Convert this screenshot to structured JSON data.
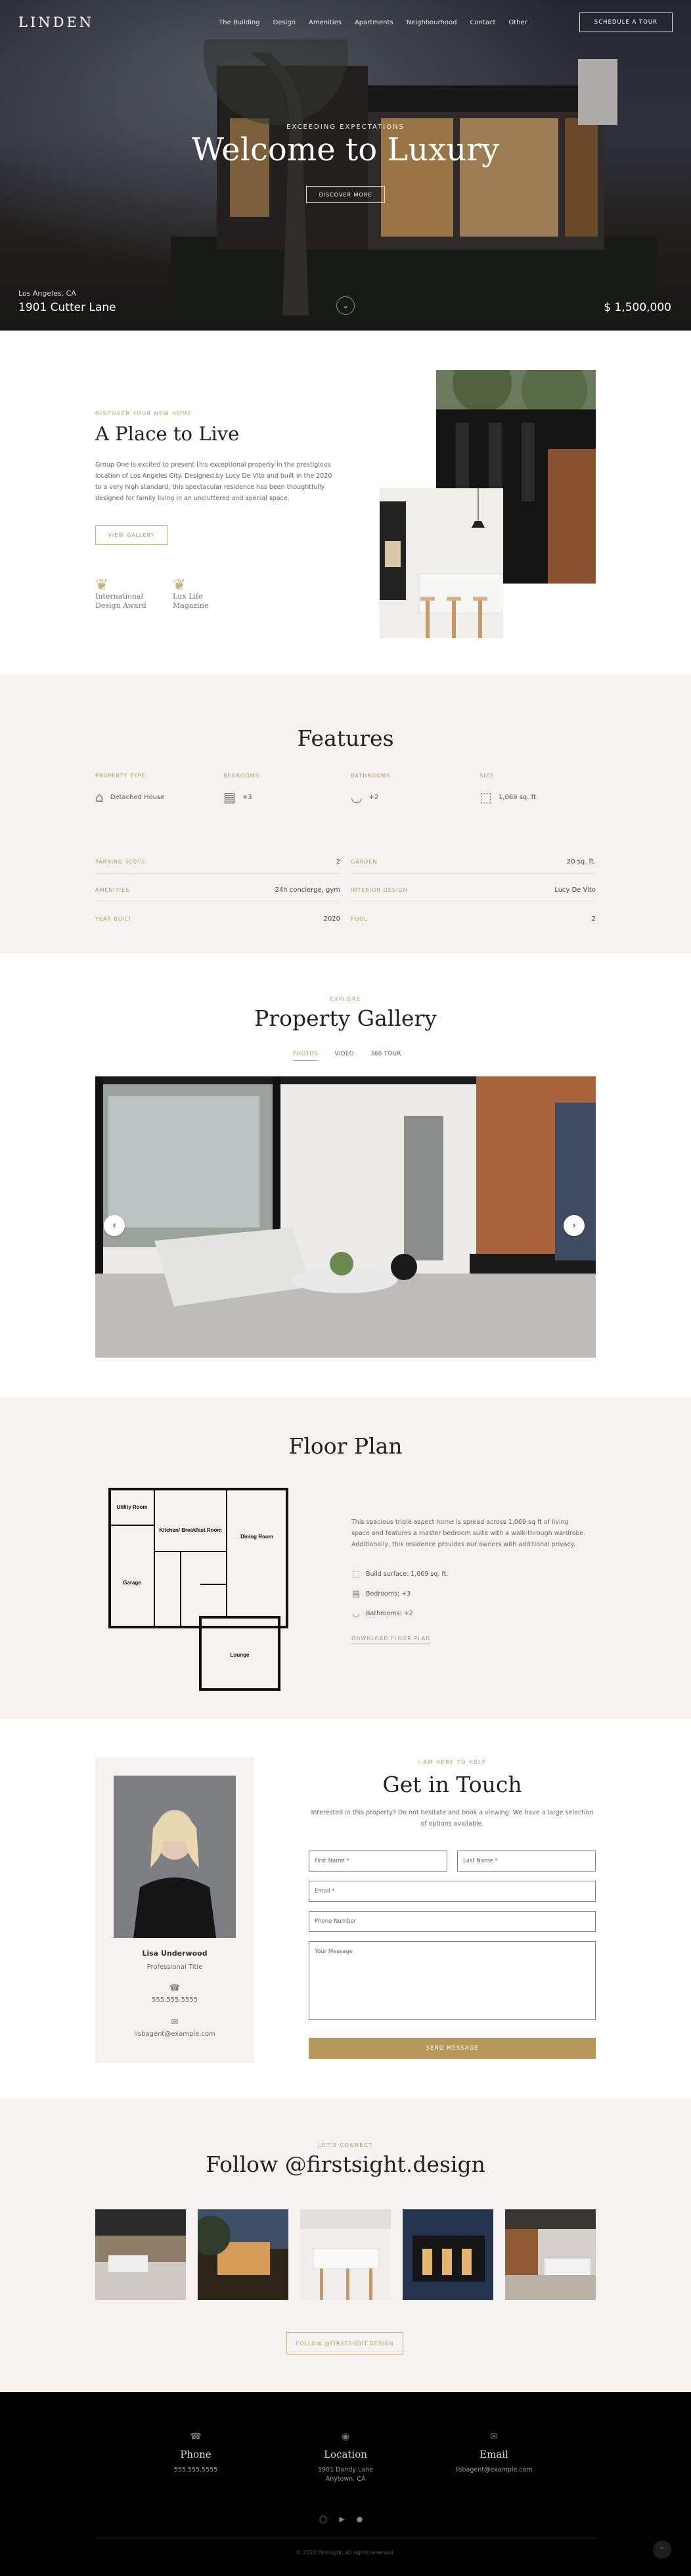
{
  "nav": {
    "logo": "LINDEN",
    "links": [
      "The Building",
      "Design",
      "Amenities",
      "Apartments",
      "Neighbourhood",
      "Contact",
      "Other"
    ],
    "cta": "SCHEDULE A TOUR"
  },
  "hero": {
    "subtitle": "EXCEEDING EXPECTATIONS",
    "title": "Welcome to Luxury",
    "button": "DISCOVER MORE",
    "location": "Los Angeles, CA",
    "address": "1901 Cutter Lane",
    "price": "$ 1,500,000",
    "scroll_icon": "chevron-down-icon"
  },
  "place": {
    "eyebrow": "DISCOVER YOUR NEW HOME",
    "title": "A Place to Live",
    "description": "Group One is excited to present this exceptional property in the prestigious location of Los Angeles City. Designed by Lucy De Vito and built in the 2020 to a very high standard, this spectacular residence has been thoughtfully designed for family living in an uncluttered and special space.",
    "button": "VIEW GALLERY",
    "awards": [
      {
        "line1": "International",
        "line2": "Design Award"
      },
      {
        "line1": "Lux Life",
        "line2": "Magazine"
      }
    ]
  },
  "features": {
    "title": "Features",
    "top": [
      {
        "label": "PROPERTY TYPE",
        "value": "Detached House",
        "icon": "house-icon"
      },
      {
        "label": "BEDROOMS",
        "value": "+3",
        "icon": "bed-icon"
      },
      {
        "label": "BATHROOMS",
        "value": "+2",
        "icon": "bathtub-icon"
      },
      {
        "label": "SIZE",
        "value": "1,069 sq. ft.",
        "icon": "area-icon"
      }
    ],
    "rows": [
      {
        "label": "PARKING SLOTS",
        "value": "2"
      },
      {
        "label": "GARDEN",
        "value": "20 sq. ft."
      },
      {
        "label": "AMENITIES",
        "value": "24h concierge, gym"
      },
      {
        "label": "INTERIOR DESIGN",
        "value": "Lucy De Vito"
      },
      {
        "label": "YEAR BUILT",
        "value": "2020"
      },
      {
        "label": "POOL",
        "value": "2"
      }
    ]
  },
  "gallery": {
    "eyebrow": "EXPLORE",
    "title": "Property Gallery",
    "tabs": [
      "PHOTOS",
      "VIDEO",
      "360 TOUR"
    ],
    "prev_icon": "chevron-left-icon",
    "next_icon": "chevron-right-icon"
  },
  "floor": {
    "title": "Floor Plan",
    "description": "This spacious triple aspect home is spread across 1,069 sq ft of living space and features a master bedroom suite with a walk-through wardrobe. Additionally, this residence provides our owners with additional privacy.",
    "items": [
      {
        "icon": "area-icon",
        "text": "Build surface: 1,069 sq. ft."
      },
      {
        "icon": "bed-icon",
        "text": "Bedrooms: +3"
      },
      {
        "icon": "bathtub-icon",
        "text": "Bathrooms: +2"
      }
    ],
    "download": "DOWNLOAD FLOOR PLAN",
    "rooms": [
      "Utility Room",
      "Kitchen/ Breakfast Room",
      "Dining Room",
      "Garage",
      "Lounge"
    ]
  },
  "contact": {
    "eyebrow": "I AM HERE TO HELP",
    "title": "Get in Touch",
    "intro": "Interested in this property? Do not hesitate and book a viewing. We have a large selection of options available.",
    "agent": {
      "name": "Lisa Underwood",
      "role": "Professional Title",
      "phone": "555.555.5555",
      "email": "lisbagent@example.com"
    },
    "fields": {
      "first": "First Name *",
      "last": "Last Name *",
      "email": "Email *",
      "phone": "Phone Number",
      "message": "Your Message"
    },
    "submit": "SEND MESSAGE"
  },
  "insta": {
    "eyebrow": "LET'S CONNECT",
    "title": "Follow @firstsight.design",
    "button": "FOLLOW @FIRSTSIGHT.DESIGN"
  },
  "footer": {
    "columns": [
      {
        "title": "Phone",
        "value": "555.555.5555",
        "value2": "",
        "icon": "phone-icon"
      },
      {
        "title": "Location",
        "value": "1901 Dandy Lane",
        "value2": "Anytown, CA",
        "icon": "location-pin-icon"
      },
      {
        "title": "Email",
        "value": "lisbagent@example.com",
        "value2": "",
        "icon": "mail-icon"
      }
    ],
    "socials": [
      "instagram-icon",
      "youtube-icon",
      "pinterest-icon"
    ],
    "copyright": "© 2022 Firstsight. All rights reserved.",
    "to_top_icon": "arrow-up-icon"
  }
}
